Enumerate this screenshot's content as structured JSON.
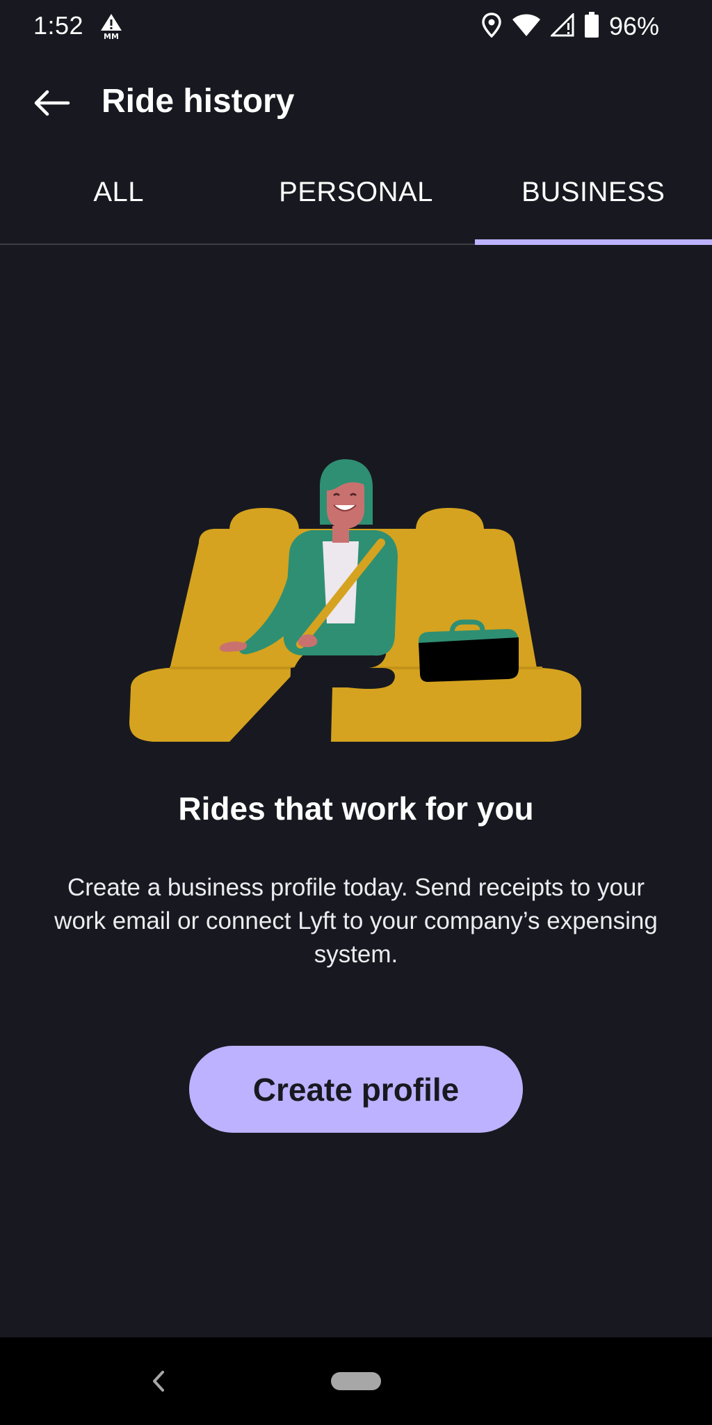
{
  "status_bar": {
    "time": "1:52",
    "battery_percent": "96%",
    "icons": [
      "warning-mm-icon",
      "location-icon",
      "wifi-icon",
      "signal-icon",
      "battery-icon"
    ]
  },
  "app_bar": {
    "title": "Ride history",
    "back_icon": "arrow-left-icon"
  },
  "tabs": [
    {
      "label": "ALL",
      "active": false
    },
    {
      "label": "PERSONAL",
      "active": false
    },
    {
      "label": "BUSINESS",
      "active": true
    }
  ],
  "empty_state": {
    "headline": "Rides that work for you",
    "description": "Create a business profile today. Send receipts to your work email or connect Lyft to your company’s expensing system.",
    "cta_label": "Create profile"
  },
  "colors": {
    "background": "#181920",
    "accent": "#bcb2ff",
    "seat": "#d5a31f",
    "jacket": "#2f8f73",
    "skin": "#c9716f"
  },
  "nav_bar": {
    "icons": [
      "nav-back-icon",
      "nav-home-pill"
    ]
  }
}
